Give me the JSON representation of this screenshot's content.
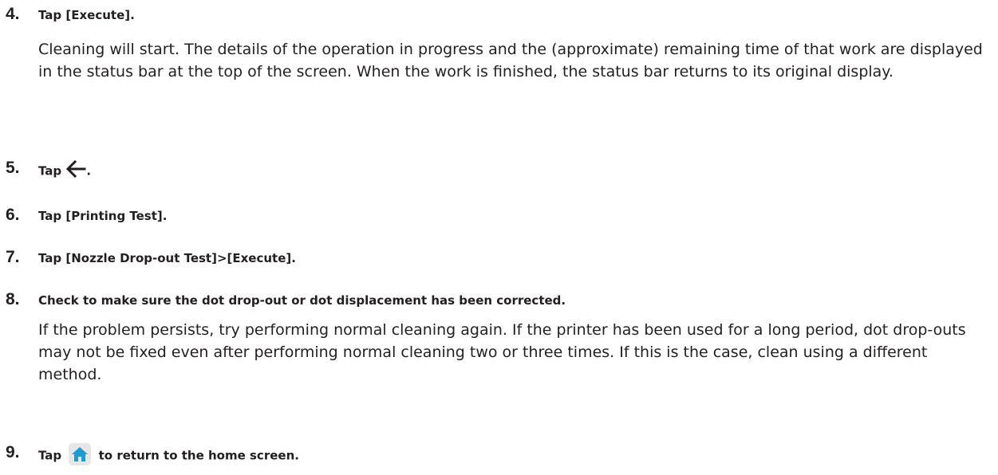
{
  "steps": [
    {
      "num": "4.",
      "heading": "Tap [Execute].",
      "body": "Cleaning will start. The details of the operation in progress and the (approximate) remaining time of that work are displayed in the status bar at the top of the screen. When the work is finished, the status bar returns to its original display."
    },
    {
      "num": "5.",
      "heading_pre": "Tap",
      "heading_icon": "back-arrow-icon",
      "heading_post": "."
    },
    {
      "num": "6.",
      "heading": "Tap [Printing Test]."
    },
    {
      "num": "7.",
      "heading": "Tap [Nozzle Drop-out Test]>[Execute]."
    },
    {
      "num": "8.",
      "heading": "Check to make sure the dot drop-out or dot displacement has been corrected.",
      "body": "If the problem persists, try performing normal cleaning again. If the printer has been used for a long period, dot drop-outs may not be fixed even after performing normal cleaning two or three times. If this is the case, clean using a different method."
    },
    {
      "num": "9.",
      "heading_pre": "Tap",
      "heading_icon": "home-icon",
      "heading_post": "to return to the home screen."
    }
  ],
  "colors": {
    "text": "#231f20",
    "home_icon_bg": "#e6e6e6",
    "home_icon_fg": "#1f9bd1"
  }
}
